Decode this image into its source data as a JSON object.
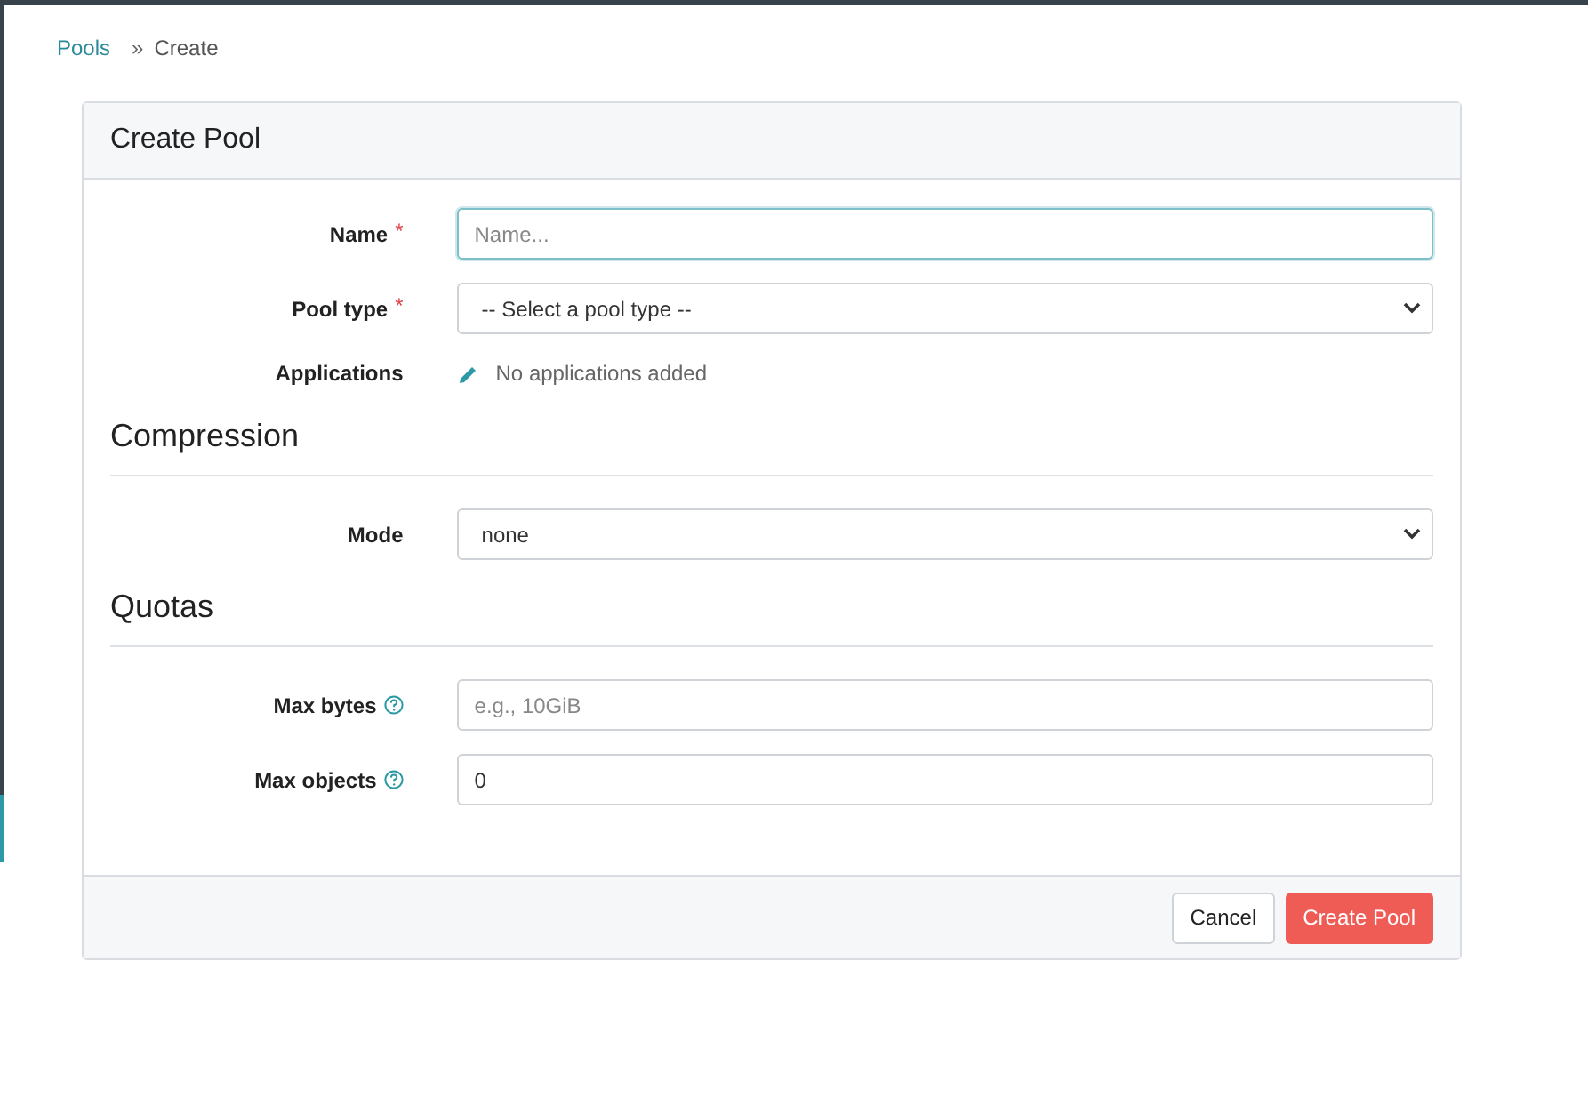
{
  "breadcrumb": [
    {
      "label": "Pools",
      "kind": "link"
    },
    {
      "label": "Create",
      "kind": "current"
    }
  ],
  "breadcrumb_separator": "»",
  "card": {
    "title": "Create Pool",
    "sections": [
      {
        "fields": [
          {
            "label": "Name",
            "kind": "text",
            "required_mark": "*",
            "help": false,
            "focused": true,
            "placeholder": "Name..."
          },
          {
            "label": "Pool type",
            "kind": "select",
            "required_mark": "*",
            "help": false,
            "focused": false,
            "value": "-- Select a pool type --"
          },
          {
            "label": "Applications",
            "kind": "apps",
            "help": false,
            "value": "No applications added"
          }
        ]
      },
      {
        "heading": "Compression",
        "fields": [
          {
            "label": "Mode",
            "kind": "select",
            "help": false,
            "focused": false,
            "value": "none"
          }
        ]
      },
      {
        "heading": "Quotas",
        "fields": [
          {
            "label": "Max bytes",
            "kind": "text",
            "help": true,
            "focused": false,
            "placeholder": "e.g., 10GiB"
          },
          {
            "label": "Max objects",
            "kind": "text",
            "help": true,
            "focused": false,
            "value": "0"
          }
        ]
      }
    ],
    "buttons": [
      {
        "label": "Cancel",
        "kind": "secondary"
      },
      {
        "label": "Create Pool",
        "kind": "primary"
      }
    ]
  }
}
